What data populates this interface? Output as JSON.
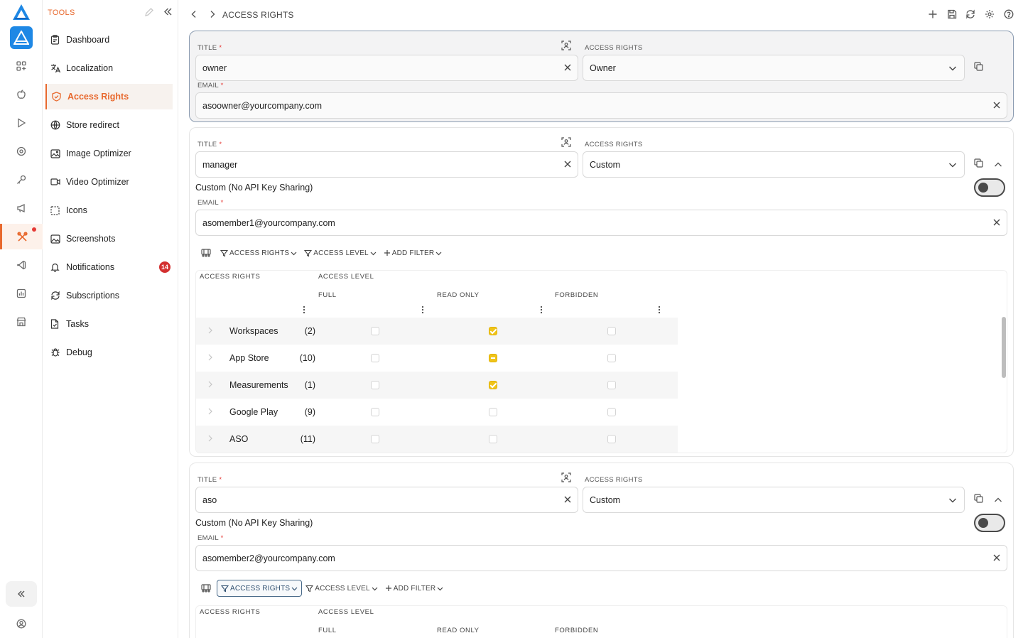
{
  "sidebar": {
    "section_label": "TOOLS",
    "items": [
      {
        "label": "Dashboard",
        "icon": "clipboard-icon"
      },
      {
        "label": "Localization",
        "icon": "translate-icon"
      },
      {
        "label": "Access Rights",
        "icon": "shield-icon",
        "active": true
      },
      {
        "label": "Store redirect",
        "icon": "globe-icon"
      },
      {
        "label": "Image Optimizer",
        "icon": "image-icon"
      },
      {
        "label": "Video Optimizer",
        "icon": "video-icon"
      },
      {
        "label": "Icons",
        "icon": "dashed-square-icon"
      },
      {
        "label": "Screenshots",
        "icon": "image-icon"
      },
      {
        "label": "Notifications",
        "icon": "bell-icon",
        "badge": "14"
      },
      {
        "label": "Subscriptions",
        "icon": "refresh-icon"
      },
      {
        "label": "Tasks",
        "icon": "file-icon"
      },
      {
        "label": "Debug",
        "icon": "bug-icon"
      }
    ]
  },
  "breadcrumb": "ACCESS RIGHTS",
  "labels": {
    "title": "TITLE",
    "access_rights": "ACCESS RIGHTS",
    "email": "EMAIL",
    "required": "*",
    "switch": "Custom (No API Key Sharing)",
    "col_access_rights": "ACCESS RIGHTS",
    "col_access_level": "ACCESS LEVEL",
    "col_full": "FULL",
    "col_read_only": "READ ONLY",
    "col_forbidden": "FORBIDDEN",
    "filter_access_rights": "ACCESS RIGHTS",
    "filter_access_level": "ACCESS LEVEL",
    "filter_add": "ADD FILTER"
  },
  "members": [
    {
      "title": "owner",
      "access": "Owner",
      "email": "asoowner@yourcompany.com"
    },
    {
      "title": "manager",
      "access": "Custom",
      "email": "asomember1@yourcompany.com",
      "custom_no_api_sharing": false,
      "rights": [
        {
          "name": "Workspaces",
          "count": "(2)",
          "level": "read_only"
        },
        {
          "name": "App Store",
          "count": "(10)",
          "level": "read_only_partial"
        },
        {
          "name": "Measurements",
          "count": "(1)",
          "level": "read_only"
        },
        {
          "name": "Google Play",
          "count": "(9)",
          "level": "none"
        },
        {
          "name": "ASO",
          "count": "(11)",
          "level": "none"
        }
      ]
    },
    {
      "title": "aso",
      "access": "Custom",
      "email": "asomember2@yourcompany.com",
      "custom_no_api_sharing": false
    }
  ],
  "colors": {
    "accent": "#e8692e",
    "checked": "#f0c419",
    "badge": "#d32f2f",
    "app_icon": "#1e88e5"
  }
}
